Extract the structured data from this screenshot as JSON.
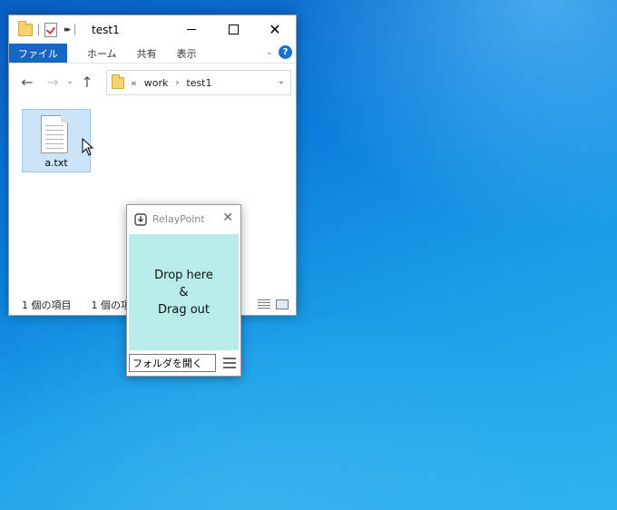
{
  "explorer": {
    "title": "test1",
    "ribbon": {
      "file_tab": "ファイル",
      "tabs": [
        "ホーム",
        "共有",
        "表示"
      ],
      "help": "?"
    },
    "address": {
      "prefix": "«",
      "crumbs": [
        "work",
        "test1"
      ]
    },
    "files": [
      {
        "name": "a.txt",
        "icon": "text-file-icon",
        "selected": true
      }
    ],
    "status": {
      "count": "1 個の項目",
      "selected": "1 個の項"
    }
  },
  "relay": {
    "app_name": "RelayPoint",
    "drop_lines": [
      "Drop here",
      "&",
      "Drag out"
    ],
    "open_folder_label": "フォルダを開く"
  },
  "colors": {
    "desktop": "#0c7fdc",
    "ribbon_file": "#1a64c4",
    "drop_zone": "#b8ece9",
    "selection": "#cce4f7"
  }
}
